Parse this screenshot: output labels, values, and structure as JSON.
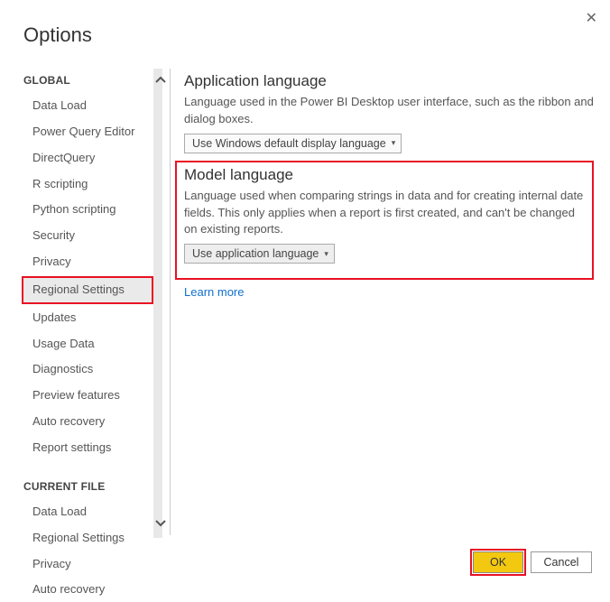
{
  "title": "Options",
  "sidebar": {
    "sections": {
      "global": {
        "header": "GLOBAL",
        "items": [
          "Data Load",
          "Power Query Editor",
          "DirectQuery",
          "R scripting",
          "Python scripting",
          "Security",
          "Privacy",
          "Regional Settings",
          "Updates",
          "Usage Data",
          "Diagnostics",
          "Preview features",
          "Auto recovery",
          "Report settings"
        ]
      },
      "current_file": {
        "header": "CURRENT FILE",
        "items": [
          "Data Load",
          "Regional Settings",
          "Privacy",
          "Auto recovery"
        ]
      }
    },
    "selected": "Regional Settings"
  },
  "content": {
    "app_lang": {
      "heading": "Application language",
      "desc": "Language used in the Power BI Desktop user interface, such as the ribbon and dialog boxes.",
      "select_value": "Use Windows default display language"
    },
    "model_lang": {
      "heading": "Model language",
      "desc": "Language used when comparing strings in data and for creating internal date fields. This only applies when a report is first created, and can't be changed on existing reports.",
      "select_value": "Use application language"
    },
    "learn_more": "Learn more"
  },
  "footer": {
    "ok": "OK",
    "cancel": "Cancel"
  }
}
